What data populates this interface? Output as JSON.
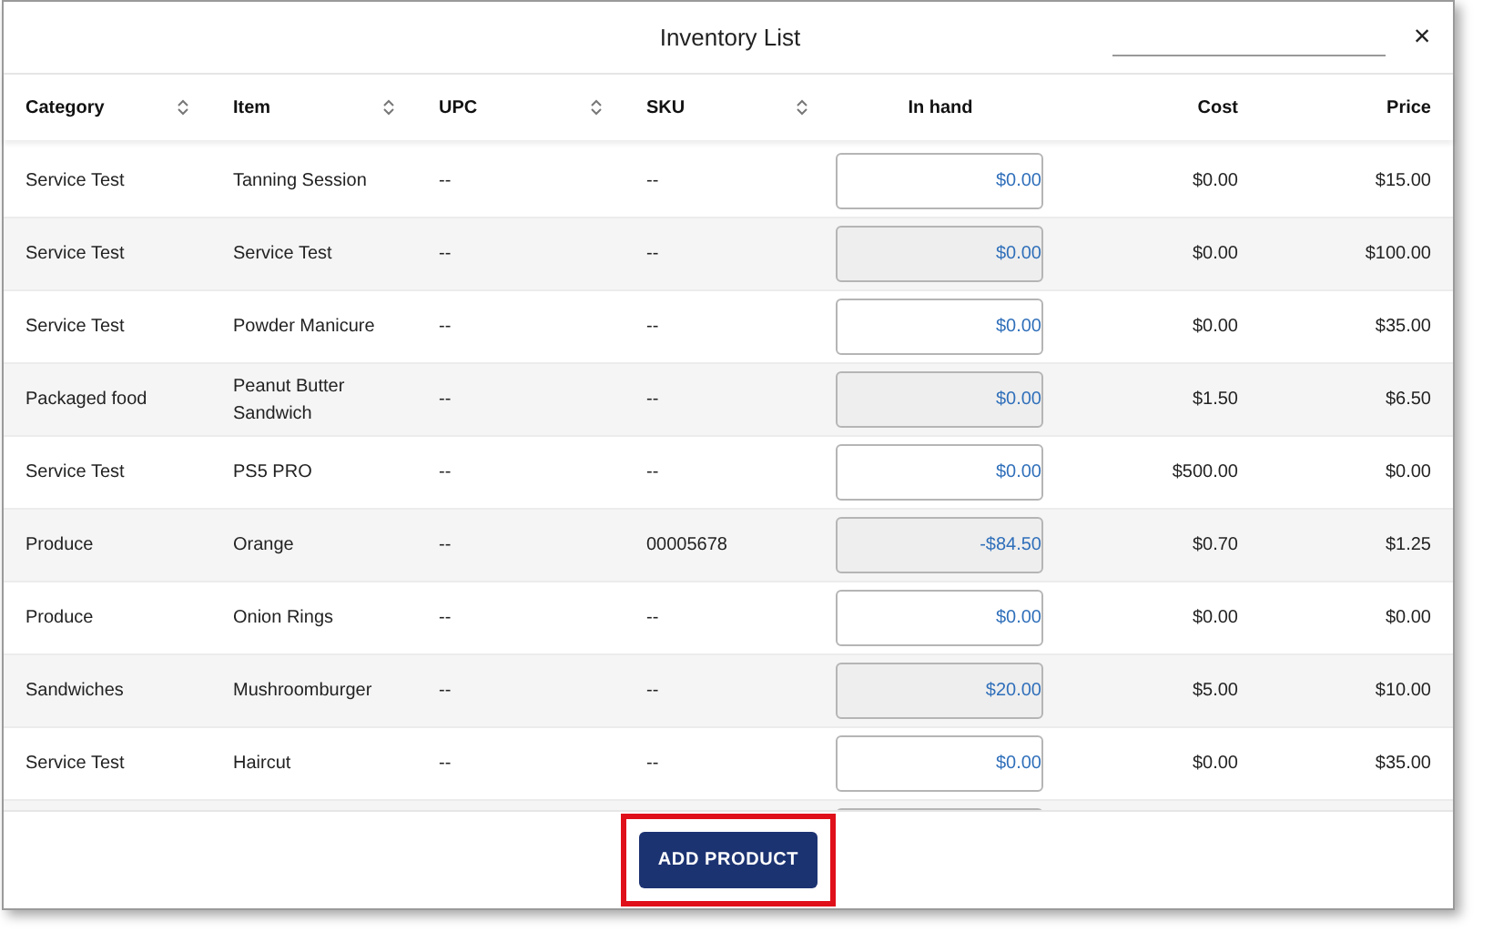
{
  "dialog": {
    "title": "Inventory List",
    "close": "×"
  },
  "table": {
    "columns": [
      {
        "label": "Category",
        "sortable": true
      },
      {
        "label": "Item",
        "sortable": true
      },
      {
        "label": "UPC",
        "sortable": true
      },
      {
        "label": "SKU",
        "sortable": true
      },
      {
        "label": "In hand",
        "sortable": false
      },
      {
        "label": "Cost",
        "sortable": false
      },
      {
        "label": "Price",
        "sortable": false
      }
    ],
    "rows": [
      {
        "category": "Service Test",
        "item": "Tanning Session",
        "upc": "--",
        "sku": "--",
        "in_hand": "$0.00",
        "cost": "$0.00",
        "price": "$15.00"
      },
      {
        "category": "Service Test",
        "item": "Service Test",
        "upc": "--",
        "sku": "--",
        "in_hand": "$0.00",
        "cost": "$0.00",
        "price": "$100.00"
      },
      {
        "category": "Service Test",
        "item": "Powder Manicure",
        "upc": "--",
        "sku": "--",
        "in_hand": "$0.00",
        "cost": "$0.00",
        "price": "$35.00"
      },
      {
        "category": "Packaged food",
        "item": "Peanut Butter Sandwich",
        "upc": "--",
        "sku": "--",
        "in_hand": "$0.00",
        "cost": "$1.50",
        "price": "$6.50"
      },
      {
        "category": "Service Test",
        "item": "PS5 PRO",
        "upc": "--",
        "sku": "--",
        "in_hand": "$0.00",
        "cost": "$500.00",
        "price": "$0.00"
      },
      {
        "category": "Produce",
        "item": "Orange",
        "upc": "--",
        "sku": "00005678",
        "in_hand": "-$84.50",
        "cost": "$0.70",
        "price": "$1.25"
      },
      {
        "category": "Produce",
        "item": "Onion Rings",
        "upc": "--",
        "sku": "--",
        "in_hand": "$0.00",
        "cost": "$0.00",
        "price": "$0.00"
      },
      {
        "category": "Sandwiches",
        "item": "Mushroomburger",
        "upc": "--",
        "sku": "--",
        "in_hand": "$20.00",
        "cost": "$5.00",
        "price": "$10.00"
      },
      {
        "category": "Service Test",
        "item": "Haircut",
        "upc": "--",
        "sku": "--",
        "in_hand": "$0.00",
        "cost": "$0.00",
        "price": "$35.00"
      }
    ]
  },
  "add_button": {
    "label": "ADD PRODUCT",
    "highlighted": true
  }
}
